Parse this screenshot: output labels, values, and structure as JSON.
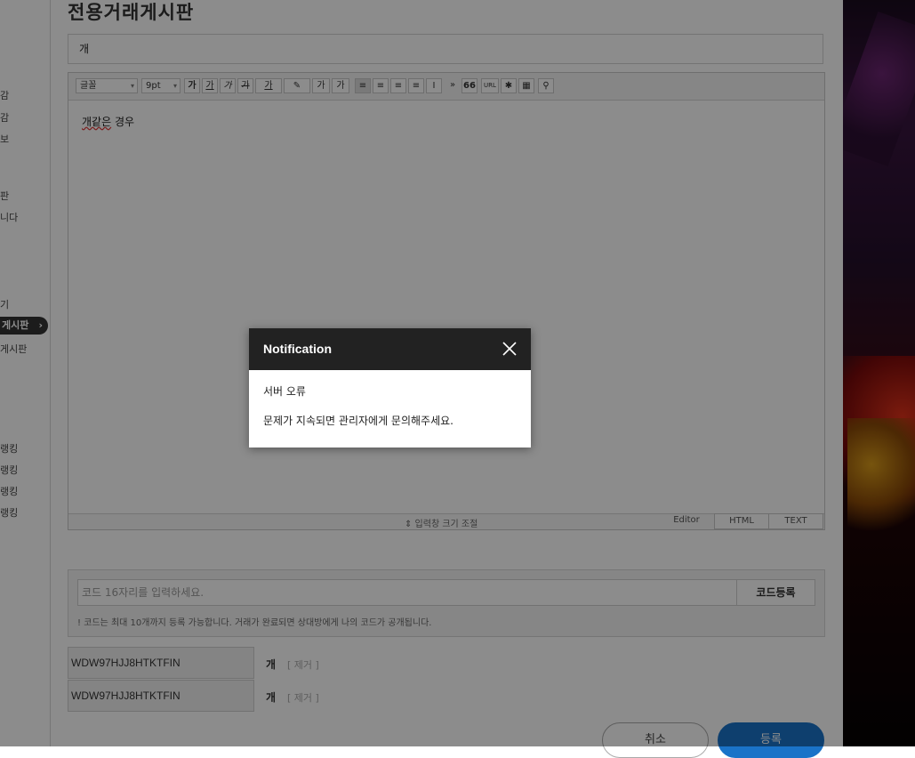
{
  "sidebar": {
    "items": [
      "감",
      "감",
      "보",
      "판",
      "니다",
      "기",
      "게시판",
      "게시판",
      "랭킹",
      "랭킹",
      "랭킹",
      "랭킹"
    ]
  },
  "board": {
    "title": "전용거래게시판",
    "subject": "개"
  },
  "editor": {
    "toolbar": {
      "font_select": "글꼴",
      "size_select": "9pt",
      "bold": "가",
      "underline": "가",
      "italic": "가",
      "strike": "가",
      "color": "가",
      "superscript": "가",
      "subscript": "가",
      "quote": "66",
      "url": "URL"
    },
    "content": {
      "typo_word": "개같은",
      "rest": " 경우"
    },
    "resize_label": "⇕ 입력창 크기 조절",
    "modes": [
      "Editor",
      "HTML",
      "TEXT"
    ]
  },
  "code_section": {
    "placeholder": "코드 16자리를 입력하세요.",
    "register_label": "코드등록",
    "note": "! 코드는 최대 10개까지 등록 가능합니다. 거래가 완료되면 상대방에게 나의 코드가 공개됩니다.",
    "codes": [
      {
        "value": "WDW97HJJ8HTKTFIN",
        "item": "개",
        "remove": "[ 제거 ]"
      },
      {
        "value": "WDW97HJJ8HTKTFIN",
        "item": "개",
        "remove": "[ 제거 ]"
      }
    ]
  },
  "actions": {
    "cancel": "취소",
    "submit": "등록"
  },
  "modal": {
    "title": "Notification",
    "line1": "서버 오류",
    "line2": "문제가 지속되면 관리자에게 문의해주세요."
  },
  "colors": {
    "submit": "#1a73c8",
    "modal_header": "#222222",
    "overlay": "rgba(0,0,0,0.45)"
  }
}
